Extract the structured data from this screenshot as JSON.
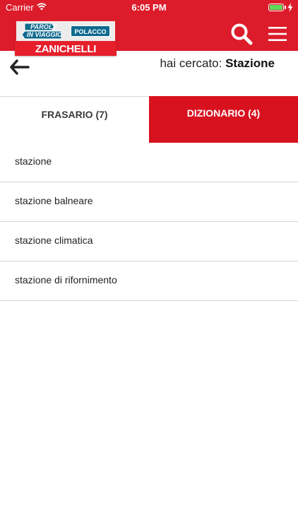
{
  "status_bar": {
    "carrier": "Carrier",
    "time": "6:05 PM",
    "icons": [
      "wifi-icon",
      "battery-icon",
      "charging-icon"
    ]
  },
  "header": {
    "logo": {
      "line1": "PAROLE",
      "line2": "IN VIAGGIO",
      "language": "POLACCO",
      "brand": "ZANICHELLI"
    },
    "icons": [
      "search-icon",
      "menu-icon"
    ],
    "colors": {
      "header_bg": "#dc1c2b",
      "language_badge": "#0f6a8e"
    }
  },
  "search": {
    "prefix": "hai cercato:",
    "term": "Stazione",
    "back_icon": "arrow-left-icon"
  },
  "tabs": [
    {
      "label": "FRASARIO (7)",
      "active": false
    },
    {
      "label": "DIZIONARIO (4)",
      "active": true
    }
  ],
  "accent_color": "#d8111f",
  "results": [
    "stazione",
    "stazione balneare",
    "stazione climatica",
    "stazione di rifornimento"
  ]
}
